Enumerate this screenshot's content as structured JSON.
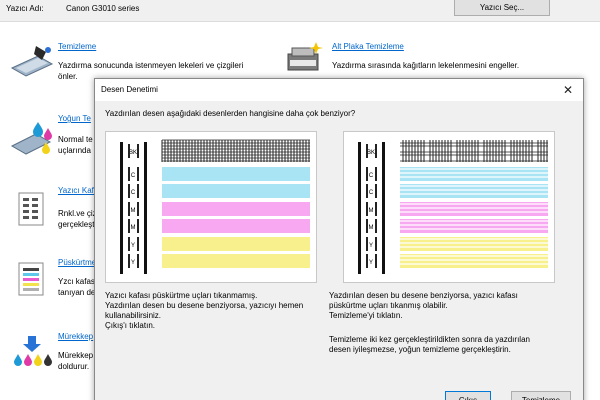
{
  "printer_bar": {
    "label": "Yazıcı Adı:",
    "printer_name": "Canon G3010 series",
    "select_button": "Yazıcı Seç..."
  },
  "sections": [
    {
      "title": "Temizleme",
      "desc_lines": [
        "Yazdırma sonucunda istenmeyen lekeleri ve çizgileri",
        "önler."
      ]
    },
    {
      "title": "Alt Plaka Temizleme",
      "desc_lines": [
        "Yazdırma sırasında kağıtların lekelenmesini engeller."
      ]
    },
    {
      "title": "Yoğun Te",
      "desc_lines": [
        "Normal te",
        "uçlarında"
      ]
    },
    {
      "title": "Yazıcı Kafa",
      "desc_lines": [
        "Rnkl.ve çiz",
        "gerçekleşti"
      ]
    },
    {
      "title": "Püskürtme",
      "desc_lines": [
        "Yzcı kafası",
        "tanıyan de"
      ]
    },
    {
      "title": "Mürekkep",
      "desc_lines": [
        "Mürekkep",
        "doldurur."
      ]
    }
  ],
  "dialog": {
    "title": "Desen Denetimi",
    "question": "Yazdırılan desen aşağıdaki desenlerden hangisine daha çok benziyor?",
    "left": {
      "labels": [
        "BK",
        "C",
        "C",
        "M",
        "M",
        "Y",
        "Y"
      ],
      "desc_lines": [
        "Yazıcı kafası püskürtme uçları tıkanmamış.",
        "Yazdırılan desen bu desene benziyorsa, yazıcıyı hemen",
        "kullanabilirsiniz.",
        "Çıkış'ı tıklatın."
      ]
    },
    "right": {
      "labels": [
        "BK",
        "C",
        "C",
        "M",
        "M",
        "Y",
        "Y"
      ],
      "desc_lines": [
        "Yazdırılan desen bu desene benziyorsa, yazıcı kafası",
        "püskürtme uçları tıkanmış olabilir.",
        "Temizleme'yi tıklatın."
      ],
      "desc2_lines": [
        "Temizleme iki kez gerçekleştirildikten sonra da yazdırılan",
        "desen iyileşmezse, yoğun temizleme gerçekleştirin."
      ]
    },
    "colors": {
      "C": "#a8e4f4",
      "M": "#f8a8f0",
      "Y": "#f8f08c",
      "BK": "#000000"
    },
    "buttons": {
      "exit": "Çıkış",
      "cleaning": "Temizleme"
    }
  }
}
